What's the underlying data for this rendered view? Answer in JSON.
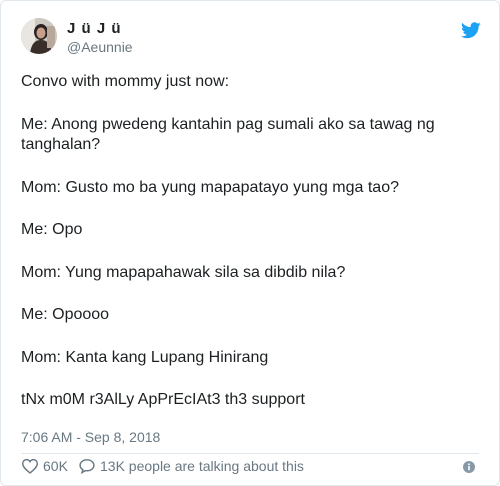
{
  "tweet": {
    "author": {
      "display_name": "J ü J ü",
      "handle": "@Aeunnie"
    },
    "paragraphs": [
      "Convo with mommy just now:",
      "Me: Anong pwedeng kantahin pag sumali ako sa tawag ng tanghalan?",
      "Mom: Gusto mo ba yung mapapatayo yung mga tao?",
      "Me: Opo",
      "Mom: Yung mapapahawak sila sa dibdib nila?",
      "Me: Opoooo",
      "Mom: Kanta kang Lupang Hinirang",
      "tNx m0M r3AlLy ApPrEcIAt3 th3 support"
    ],
    "timestamp": "7:06 AM - Sep 8, 2018",
    "likes": "60K",
    "talking": "13K people are talking about this"
  },
  "icons": {
    "brand": "twitter-bird-icon",
    "like": "heart-outline-icon",
    "reply": "speech-bubble-icon",
    "info": "info-icon"
  },
  "colors": {
    "brand_blue": "#1da1f2",
    "text": "#1c2022",
    "muted": "#697882",
    "border": "#e1e8ed"
  }
}
